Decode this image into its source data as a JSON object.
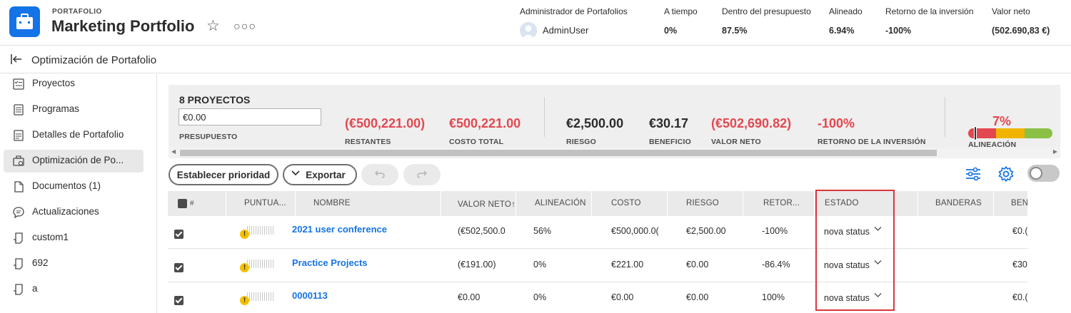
{
  "header": {
    "kicker": "PORTAFOLIO",
    "title": "Marketing Portfolio",
    "admin_label": "Administrador de Portafolios",
    "admin_name": "AdminUser",
    "metrics": [
      {
        "label": "A tiempo",
        "value": "0%"
      },
      {
        "label": "Dentro del presupuesto",
        "value": "87.5%"
      },
      {
        "label": "Alineado",
        "value": "6.94%"
      },
      {
        "label": "Retorno de la inversión",
        "value": "-100%"
      },
      {
        "label": "Valor neto",
        "value": "(502.690,83 €)"
      }
    ],
    "accent": "#1473e6"
  },
  "subheader": {
    "title": "Optimización de Portafolio"
  },
  "sidebar": {
    "items": [
      {
        "label": "Proyectos",
        "icon": "projects-icon"
      },
      {
        "label": "Programas",
        "icon": "programs-icon"
      },
      {
        "label": "Detalles de Portafolio",
        "icon": "details-icon"
      },
      {
        "label": "Optimización de Po...",
        "icon": "optimizer-icon",
        "active": true
      },
      {
        "label": "Documentos (1)",
        "icon": "document-icon"
      },
      {
        "label": "Actualizaciones",
        "icon": "comment-icon"
      },
      {
        "label": "custom1",
        "icon": "custom-page-icon"
      },
      {
        "label": "692",
        "icon": "custom-page-icon"
      },
      {
        "label": "a",
        "icon": "custom-page-icon"
      }
    ]
  },
  "summary": {
    "count_title": "8 PROYECTOS",
    "budget_value": "€0.00",
    "budget_label": "PRESUPUESTO",
    "remaining_value": "(€500,221.00)",
    "remaining_label": "RESTANTES",
    "total_cost_value": "€500,221.00",
    "total_cost_label": "COSTO TOTAL",
    "risk_value": "€2,500.00",
    "risk_label": "RIESGO",
    "benefit_value": "€30.17",
    "benefit_label": "BENEFICIO",
    "net_value_value": "(€502,690.82)",
    "net_value_label": "VALOR NETO",
    "roi_value": "-100%",
    "roi_label": "RETORNO DE LA INVERSIÓN",
    "alignment_value": "7%",
    "alignment_label": "ALINEACIÓN",
    "alignment_level": 0.07,
    "negative_color": "#e34850"
  },
  "toolbar": {
    "prioritize_label": "Establecer prioridad",
    "export_label": "Exportar"
  },
  "table": {
    "columns": [
      "#",
      "PUNTUA...",
      "NOMBRE",
      "VALOR NETO",
      "ALINEACIÓN",
      "COSTO",
      "RIESGO",
      "RETOR...",
      "ESTADO",
      "BANDERAS",
      "BEN"
    ],
    "rows": [
      {
        "name": "2021 user conference",
        "net_value": "(€502,500.0",
        "alignment": "56%",
        "cost": "€500,000.0(",
        "risk": "€2,500.00",
        "roi": "-100%",
        "status": "nova status",
        "benefit": "€0.("
      },
      {
        "name": "Practice Projects",
        "net_value": "(€191.00)",
        "alignment": "0%",
        "cost": "€221.00",
        "risk": "€0.00",
        "roi": "-86.4%",
        "status": "nova status",
        "benefit": "€30"
      },
      {
        "name": "0000113",
        "net_value": "€0.00",
        "alignment": "0%",
        "cost": "€0.00",
        "risk": "€0.00",
        "roi": "100%",
        "status": "nova status",
        "benefit": "€0.("
      }
    ]
  }
}
